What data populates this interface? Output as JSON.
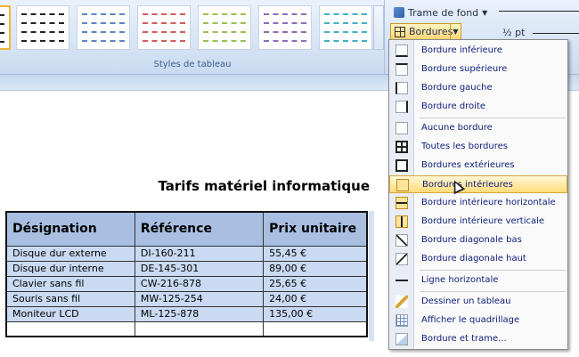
{
  "ribbon": {
    "styles_group_label": "Styles de tableau",
    "shading_label": "Trame de fond",
    "borders_label": "Bordures",
    "pen_weight": "½ pt"
  },
  "table_style_thumbnails": [
    {
      "line_color": "#222222"
    },
    {
      "line_color": "#222222"
    },
    {
      "line_color": "#5b86c4"
    },
    {
      "line_color": "#d45a5a"
    },
    {
      "line_color": "#9bbf52"
    },
    {
      "line_color": "#8a6fb8"
    },
    {
      "line_color": "#3fb0c9"
    }
  ],
  "document": {
    "title": "Tarifs matériel informatique",
    "table": {
      "headers": [
        "Désignation",
        "Référence",
        "Prix unitaire"
      ],
      "rows": [
        [
          "Disque dur externe",
          "DI-160-211",
          "55,45 €"
        ],
        [
          "Disque dur interne",
          "DE-145-301",
          "89,00 €"
        ],
        [
          "Clavier sans fil",
          "CW-216-878",
          "25,65 €"
        ],
        [
          "Souris sans fil",
          "MW-125-254",
          "24,00 €"
        ],
        [
          "Moniteur LCD",
          "ML-125-878",
          "135,00 €"
        ],
        [
          "",
          "",
          ""
        ]
      ]
    }
  },
  "borders_menu": {
    "items": [
      {
        "label": "Bordure inférieure",
        "icon": "border-bottom-icon"
      },
      {
        "label": "Bordure supérieure",
        "icon": "border-top-icon"
      },
      {
        "label": "Bordure gauche",
        "icon": "border-left-icon"
      },
      {
        "label": "Bordure droite",
        "icon": "border-right-icon"
      },
      {
        "label": "Aucune bordure",
        "icon": "no-border-icon"
      },
      {
        "label": "Toutes les bordures",
        "icon": "all-borders-icon"
      },
      {
        "label": "Bordures extérieures",
        "icon": "outside-borders-icon"
      },
      {
        "label": "Bordures intérieures",
        "icon": "inside-borders-icon",
        "highlighted": true
      },
      {
        "label": "Bordure intérieure horizontale",
        "icon": "inside-horizontal-border-icon"
      },
      {
        "label": "Bordure intérieure verticale",
        "icon": "inside-vertical-border-icon"
      },
      {
        "label": "Bordure diagonale bas",
        "icon": "diagonal-down-border-icon"
      },
      {
        "label": "Bordure diagonale haut",
        "icon": "diagonal-up-border-icon"
      },
      {
        "label": "Ligne horizontale",
        "icon": "horizontal-line-icon"
      },
      {
        "label": "Dessiner un tableau",
        "icon": "draw-table-icon"
      },
      {
        "label": "Afficher le quadrillage",
        "icon": "view-gridlines-icon"
      },
      {
        "label": "Bordure et trame...",
        "icon": "borders-and-shading-icon"
      }
    ]
  },
  "colors": {
    "header_fill": "#a8bfe2",
    "row_fill": "#c9daf2",
    "highlight": "#ffdc7a",
    "menu_text": "#11207a"
  }
}
